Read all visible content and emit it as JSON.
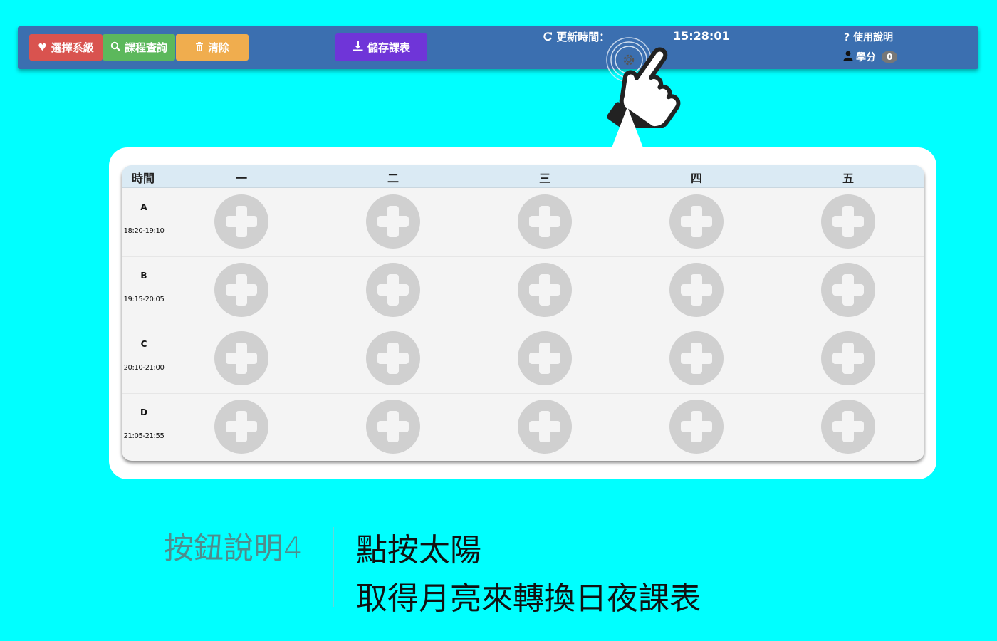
{
  "navbar": {
    "select_dept_label": "選擇系級",
    "course_search_label": "課程查詢",
    "clear_label": "清除",
    "save_schedule_label": "儲存課表",
    "update_time_label": "更新時間：",
    "update_time_value": "15:28:01",
    "help_label": "使用說明",
    "credits_label": "學分",
    "credits_value": "0",
    "icons": [
      "heart-icon",
      "search-icon",
      "trash-icon",
      "download-icon",
      "refresh-icon",
      "question-icon",
      "user-icon",
      "gear-icon",
      "pointing-hand-icon"
    ]
  },
  "schedule": {
    "time_header": "時間",
    "days": [
      "一",
      "二",
      "三",
      "四",
      "五"
    ],
    "periods": [
      {
        "code": "A",
        "time": "18:20-19:10"
      },
      {
        "code": "B",
        "time": "19:15-20:05"
      },
      {
        "code": "C",
        "time": "20:10-21:00"
      },
      {
        "code": "D",
        "time": "21:05-21:55"
      }
    ],
    "cell_icon": "plus-circle-icon"
  },
  "caption": {
    "title": "按鈕說明4",
    "line1": "點按太陽",
    "line2": "取得月亮來轉換日夜課表"
  },
  "colors": {
    "background": "#00ffff",
    "navbar": "#3b6fb0",
    "btn_red": "#d9534f",
    "btn_green": "#5cb85c",
    "btn_orange": "#f0ad4e",
    "btn_purple": "#6f35d8"
  }
}
